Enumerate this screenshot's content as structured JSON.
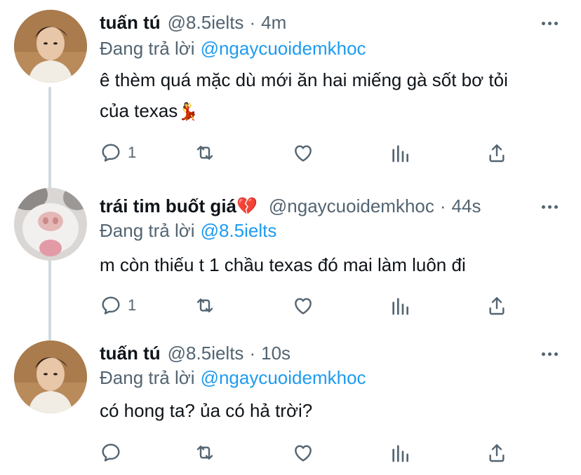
{
  "tweets": [
    {
      "name": "tuấn tú",
      "handle": "@8.5ielts",
      "separator": "·",
      "time": "4m",
      "replying_label": "Đang trả lời",
      "replying_to": "@ngaycuoidemkhoc",
      "text_line1": "ê thèm quá mặc dù mới ăn hai miếng gà sốt bơ tỏi",
      "text_line2": "của texas",
      "text_emoji": "💃",
      "reply_count": "1"
    },
    {
      "name": "trái tim buốt giá",
      "name_emoji": "💔",
      "handle": "@ngaycuoidemkhoc",
      "separator": "·",
      "time": "44s",
      "replying_label": "Đang trả lời",
      "replying_to": "@8.5ielts",
      "text_line1": "m còn thiếu t 1 chầu texas đó mai làm luôn đi",
      "reply_count": "1"
    },
    {
      "name": "tuấn tú",
      "handle": "@8.5ielts",
      "separator": "·",
      "time": "10s",
      "replying_label": "Đang trả lời",
      "replying_to": "@ngaycuoidemkhoc",
      "text_line1": "có hong ta? ủa có hả trời?",
      "reply_count": ""
    }
  ],
  "icons": {
    "reply": "reply-icon",
    "retweet": "retweet-icon",
    "like": "like-icon",
    "analytics": "analytics-icon",
    "share": "share-icon",
    "more": "more-icon"
  },
  "colors": {
    "mention": "#1d9bf0",
    "secondary_text": "#536471",
    "thread_line": "#cfd9de"
  }
}
